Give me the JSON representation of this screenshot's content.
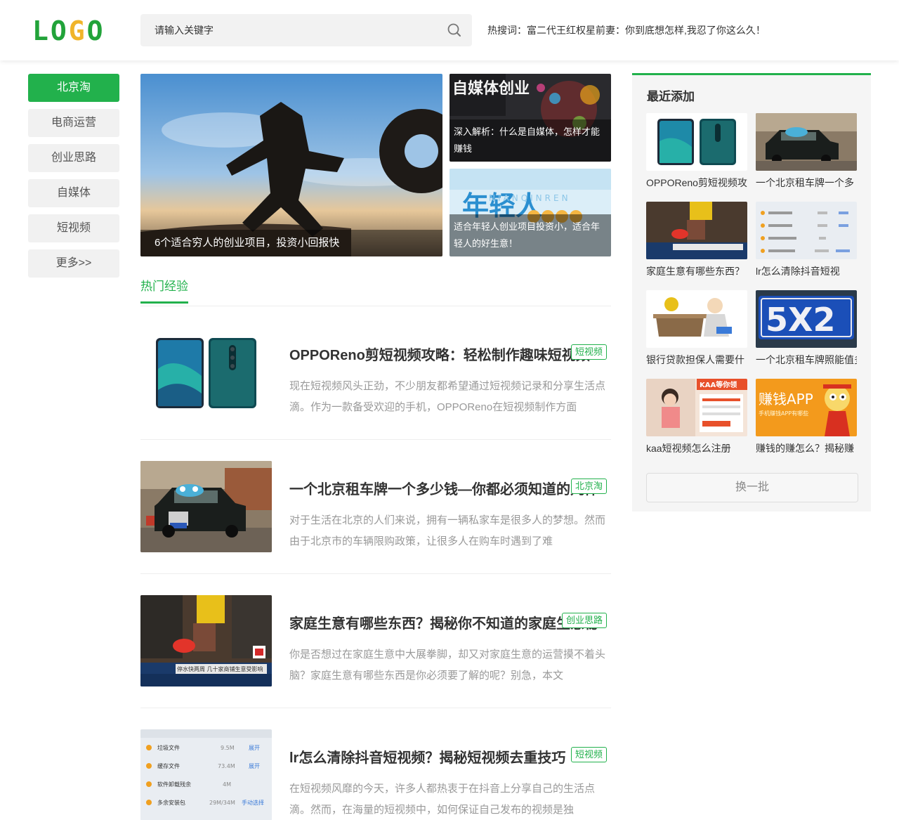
{
  "header": {
    "logo": [
      "L",
      "O",
      "G",
      "O"
    ],
    "search_placeholder": "请输入关键字",
    "hot_words": "热搜词：富二代王红权星前妻：你到底想怎样,我忍了你这么久！"
  },
  "nav": {
    "items": [
      {
        "label": "北京淘",
        "active": true
      },
      {
        "label": "电商运营",
        "active": false
      },
      {
        "label": "创业思路",
        "active": false
      },
      {
        "label": "自媒体",
        "active": false
      },
      {
        "label": "短视频",
        "active": false
      },
      {
        "label": "更多>>",
        "active": false
      }
    ]
  },
  "hero": {
    "main_caption": "6个适合穷人的创业项目，投资小回报快",
    "side": [
      {
        "caption": "深入解析：什么是自媒体，怎样才能赚钱"
      },
      {
        "caption": "适合年轻人创业项目投资小，适合年轻人的好生意！"
      }
    ]
  },
  "section": {
    "tab": "热门经验"
  },
  "articles": [
    {
      "title": "OPPOReno剪短视频攻略：轻松制作趣味短视频",
      "tag": "短视频",
      "desc": "现在短视频风头正劲，不少朋友都希望通过短视频记录和分享生活点滴。作为一款备受欢迎的手机，OPPOReno在短视频制作方面"
    },
    {
      "title": "一个北京租车牌一个多少钱—你都必须知道的几件",
      "tag": "北京淘",
      "desc": "对于生活在北京的人们来说，拥有一辆私家车是很多人的梦想。然而由于北京市的车辆限购政策，让很多人在购车时遇到了难"
    },
    {
      "title": "家庭生意有哪些东西？揭秘你不知道的家庭生意秘",
      "tag": "创业思路",
      "desc": "你是否想过在家庭生意中大展拳脚，却又对家庭生意的运营摸不着头脑？家庭生意有哪些东西是你必须要了解的呢？别急，本文"
    },
    {
      "title": "lr怎么清除抖音短视频？揭秘短视频去重技巧",
      "tag": "短视频",
      "desc": "在短视频风靡的今天，许多人都热衷于在抖音上分享自己的生活点滴。然而，在海量的短视频中，如何保证自己发布的视频是独"
    }
  ],
  "recent": {
    "title": "最近添加",
    "items": [
      {
        "label": "OPPOReno剪短视频攻"
      },
      {
        "label": "一个北京租车牌一个多"
      },
      {
        "label": "家庭生意有哪些东西？"
      },
      {
        "label": "lr怎么清除抖音短视"
      },
      {
        "label": "银行贷款担保人需要什"
      },
      {
        "label": "一个北京租车牌照能值多"
      },
      {
        "label": "kaa短视频怎么注册"
      },
      {
        "label": "赚钱的赚怎么？揭秘赚"
      }
    ],
    "refresh": "换一批"
  },
  "thumb_text": {
    "hero_side1_top": "自媒体创业",
    "hero_side2_big": "年轻人",
    "hero_side2_en": "NIANQINREN",
    "plate": "5X2",
    "app_title": "赚钱APP",
    "app_sub": "手机赚钱APP有哪些",
    "kaa_banner": "KAA等你领",
    "news_banner": "停水快两周 几十家商铺生意受影响",
    "file_rows": [
      {
        "name": "垃圾文件",
        "size": "9.5M",
        "action": "展开"
      },
      {
        "name": "缓存文件",
        "size": "73.4M",
        "action": "展开"
      },
      {
        "name": "软件卸载残余",
        "size": "4M",
        "action": ""
      },
      {
        "name": "多余安装包",
        "size": "29M/34M",
        "action": "手动选择"
      }
    ]
  },
  "colors": {
    "accent": "#22b14c",
    "logo_o": "#f0b42a"
  }
}
